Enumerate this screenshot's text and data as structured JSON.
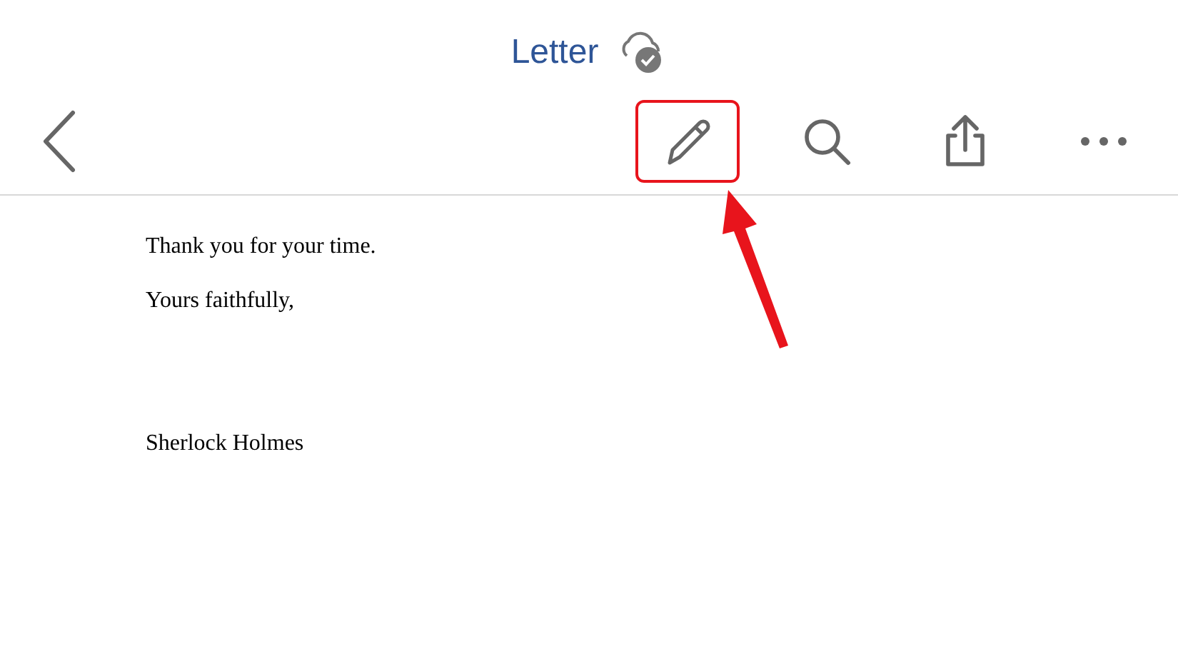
{
  "header": {
    "title": "Letter",
    "synced": true
  },
  "toolbar": [
    {
      "kind": "edit",
      "highlighted": true
    },
    {
      "kind": "search",
      "highlighted": false
    },
    {
      "kind": "share",
      "highlighted": false
    },
    {
      "kind": "more",
      "highlighted": false
    }
  ],
  "document": {
    "lines": [
      "Thank you for your time.",
      "Yours faithfully,"
    ],
    "signature": "Sherlock Holmes"
  }
}
